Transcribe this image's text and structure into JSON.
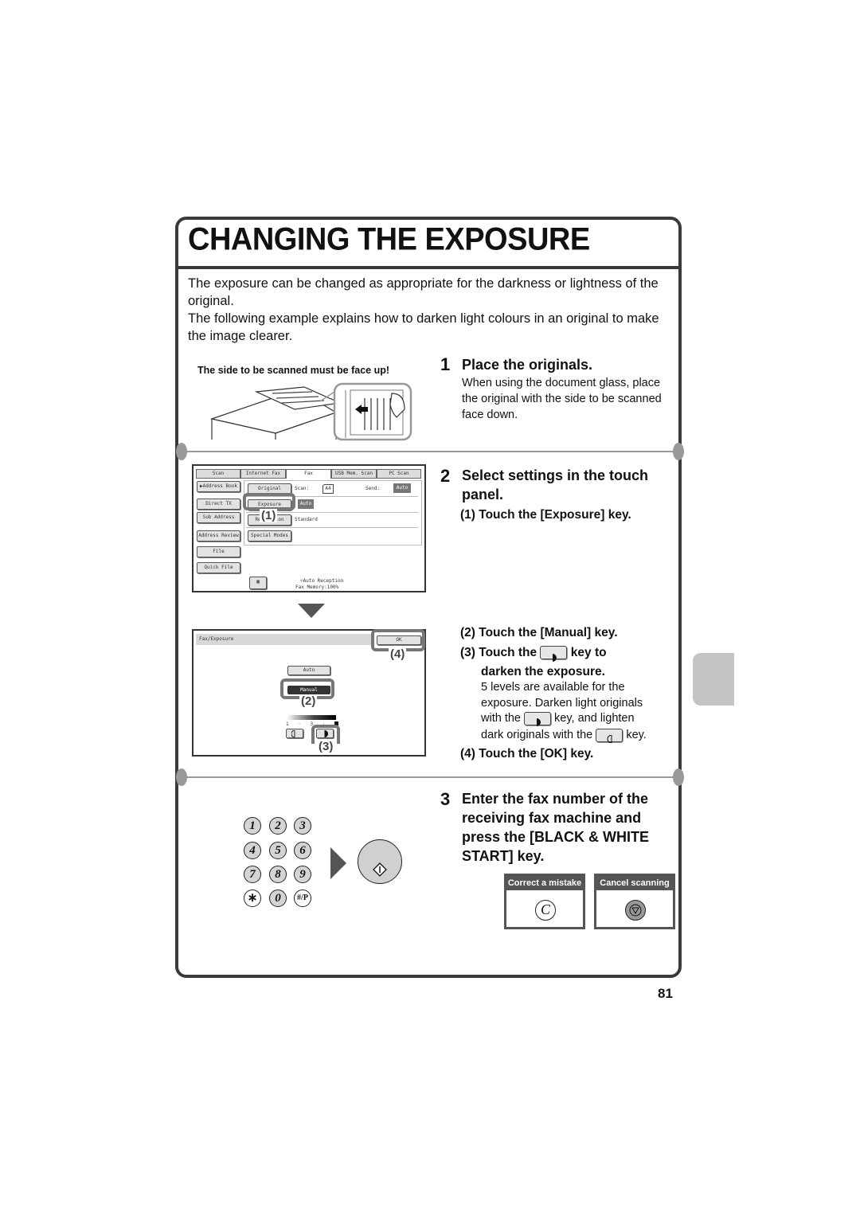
{
  "page": {
    "title": "CHANGING THE EXPOSURE",
    "page_number": "81",
    "intro": [
      "The exposure can be changed as appropriate for the darkness or lightness of the original.",
      "The following example explains how to darken light colours in an original to make the image clearer."
    ]
  },
  "step1": {
    "number": "1",
    "title": "Place the originals.",
    "desc": "When using the document glass, place the original with the side to be scanned face down.",
    "illustration_caption": "The side to be scanned must be face up!"
  },
  "step2": {
    "number": "2",
    "title_line1": "Select settings in the touch",
    "title_line2": "panel.",
    "substeps": {
      "s1": "(1) Touch the [Exposure] key.",
      "s2": "(2) Touch the [Manual] key.",
      "s3_prefix": "(3) Touch the",
      "s3_suffix": "key to",
      "s3_line2": "darken the exposure.",
      "s3_desc_line1": "5 levels are available for the",
      "s3_desc_line2": "exposure. Darken light originals",
      "s3_desc_line3a": "with the",
      "s3_desc_line3b": "key, and lighten",
      "s3_desc_line4a": "dark originals with the",
      "s3_desc_line4b": "key.",
      "s4": "(4) Touch the [OK] key."
    }
  },
  "panel1": {
    "tabs": [
      "Scan",
      "Internet Fax",
      "Fax",
      "USB Mem. Scan",
      "PC Scan"
    ],
    "active_tab": "Fax",
    "side_buttons": [
      "▶Address Book",
      "Direct TX",
      "Sub Address",
      "Address Review",
      "File",
      "Quick File"
    ],
    "rows": {
      "original_label": "Original",
      "scan_label": "Scan:",
      "scan_value": "A4",
      "send_label": "Send:",
      "send_value": "Auto",
      "exposure_label": "Exposure",
      "exposure_value": "Auto",
      "resolution_label": "Resolution",
      "resolution_value": "Standard",
      "special_label": "Special Modes"
    },
    "status_line1": "Auto Reception",
    "status_line2": "Fax Memory:100%",
    "callout": "(1)"
  },
  "panel2": {
    "header": "Fax/Exposure",
    "ok_label": "OK",
    "auto_label": "Auto",
    "manual_label": "Manual",
    "scale_ticks": [
      "1",
      "·",
      "3",
      "·",
      "5"
    ],
    "exposure_level": 5,
    "callouts": [
      "(2)",
      "(3)",
      "(4)"
    ]
  },
  "keypad": {
    "keys": [
      "1",
      "2",
      "3",
      "4",
      "5",
      "6",
      "7",
      "8",
      "9",
      "∗",
      "0",
      "#/P"
    ]
  },
  "step3": {
    "number": "3",
    "title_lines": [
      "Enter the fax number of the",
      "receiving fax machine and",
      "press the [BLACK & WHITE",
      "START] key."
    ],
    "correct_label": "Correct a mistake",
    "correct_key": "C",
    "cancel_label": "Cancel scanning"
  }
}
